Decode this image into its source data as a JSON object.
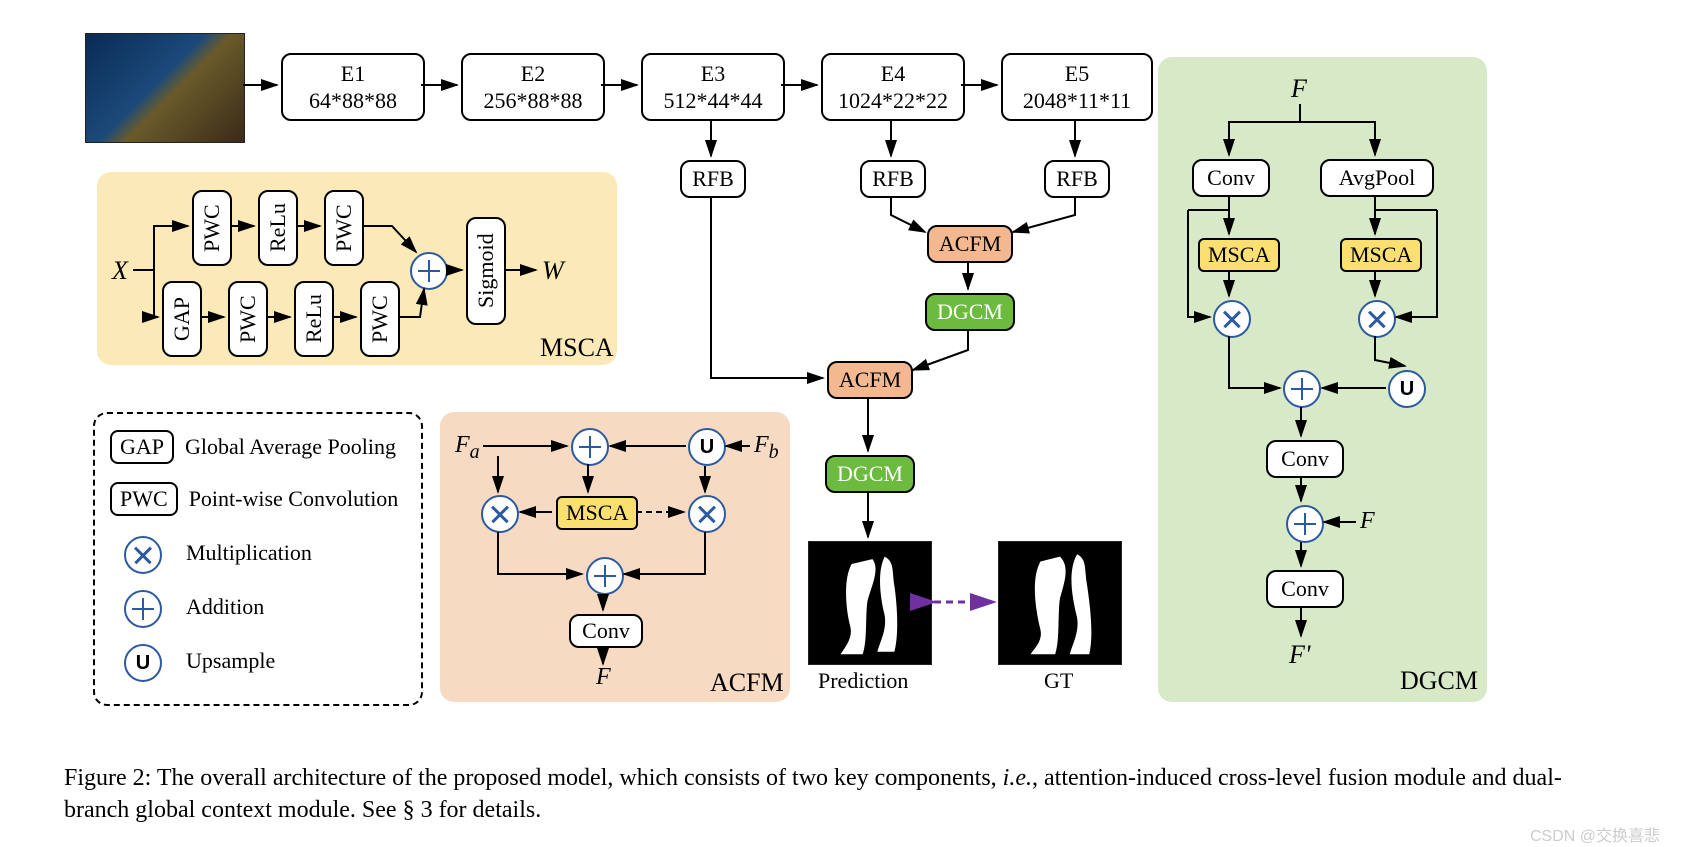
{
  "encoder": {
    "e1": {
      "name": "E1",
      "dims": "64*88*88"
    },
    "e2": {
      "name": "E2",
      "dims": "256*88*88"
    },
    "e3": {
      "name": "E3",
      "dims": "512*44*44"
    },
    "e4": {
      "name": "E4",
      "dims": "1024*22*22"
    },
    "e5": {
      "name": "E5",
      "dims": "2048*11*11"
    }
  },
  "rfb": "RFB",
  "modules": {
    "acfm": "ACFM",
    "dgcm": "DGCM",
    "msca": "MSCA",
    "conv": "Conv",
    "avgpool": "AvgPool"
  },
  "msca_block": {
    "input": "X",
    "output": "W",
    "ops": {
      "gap": "GAP",
      "pwc": "PWC",
      "relu": "ReLu",
      "sigmoid": "Sigmoid"
    },
    "label": "MSCA"
  },
  "acfm_block": {
    "fa": "F",
    "fa_sub": "a",
    "fb": "F",
    "fb_sub": "b",
    "out": "F",
    "label": "ACFM",
    "conv": "Conv"
  },
  "dgcm_block": {
    "in": "F",
    "out": "F'",
    "label": "DGCM"
  },
  "outputs": {
    "pred": "Prediction",
    "gt": "GT"
  },
  "legend": {
    "gap": "GAP",
    "gap_txt": "Global Average Pooling",
    "pwc": "PWC",
    "pwc_txt": "Point-wise Convolution",
    "mult": "Multiplication",
    "add": "Addition",
    "up": "Upsample"
  },
  "caption_a": "Figure 2: The overall architecture of the proposed model, which consists of two key components, ",
  "caption_b": "i.e.",
  "caption_c": ", attention-induced cross-level fusion module and dual-branch global context module. See § 3 for details.",
  "watermark": "CSDN @交换喜悲"
}
